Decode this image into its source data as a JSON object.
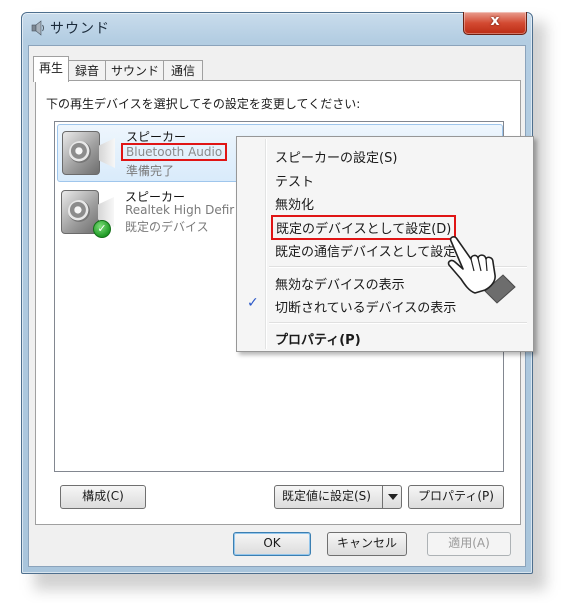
{
  "window": {
    "title": "サウンド",
    "close_glyph": "x"
  },
  "tabs": [
    {
      "label": "再生"
    },
    {
      "label": "録音"
    },
    {
      "label": "サウンド"
    },
    {
      "label": "通信"
    }
  ],
  "playback": {
    "instruction": "下の再生デバイスを選択してその設定を変更してください:",
    "devices": [
      {
        "name": "スピーカー",
        "line2": "Bluetooth Audio",
        "line3": "準備完了"
      },
      {
        "name": "スピーカー",
        "line2": "Realtek High Defir",
        "line3": "既定のデバイス"
      }
    ],
    "buttons": {
      "configure": "構成(C)",
      "set_default": "既定値に設定(S)",
      "properties": "プロパティ(P)"
    }
  },
  "context_menu": {
    "items": [
      {
        "label": "スピーカーの設定(S)"
      },
      {
        "label": "テスト"
      },
      {
        "label": "無効化"
      },
      {
        "label": "既定のデバイスとして設定(D)"
      },
      {
        "label": "既定の通信デバイスとして設定"
      },
      {
        "label": "無効なデバイスの表示"
      },
      {
        "label": "切断されているデバイスの表示",
        "checked": true
      },
      {
        "label": "プロパティ(P)",
        "bold": true
      }
    ],
    "check_glyph": "✓"
  },
  "dialog_buttons": {
    "ok": "OK",
    "cancel": "キャンセル",
    "apply": "適用(A)"
  },
  "colors": {
    "highlight_box": "#e01515",
    "title_bar": "#b3cde2",
    "close_button": "#d34a32",
    "check_mark": "#2b58c8"
  }
}
